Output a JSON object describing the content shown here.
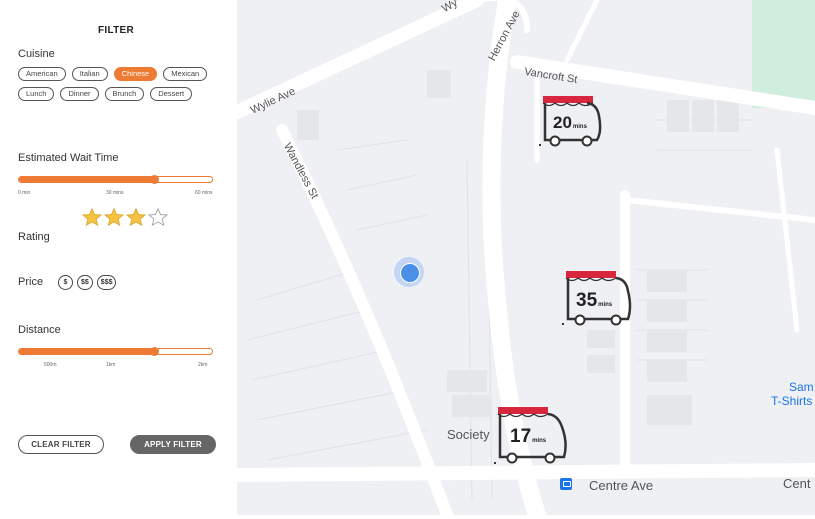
{
  "filter": {
    "title": "FILTER",
    "cuisine": {
      "label": "Cuisine",
      "options_row1": [
        "American",
        "Italian",
        "Chinese",
        "Mexican"
      ],
      "options_row2": [
        "Lunch",
        "Dinner",
        "Brunch",
        "Dessert"
      ],
      "selected": "Chinese"
    },
    "wait_time": {
      "label": "Estimated Wait Time",
      "value_fraction": 0.7,
      "ticks": [
        "0 min",
        "30 mins",
        "60 mins"
      ]
    },
    "rating": {
      "label": "Rating",
      "stars_filled": 3,
      "stars_total": 4
    },
    "price": {
      "label": "Price",
      "options": [
        "$",
        "$$",
        "$$$"
      ]
    },
    "distance": {
      "label": "Distance",
      "value_fraction": 0.7,
      "ticks": [
        "500m",
        "1km",
        "2km"
      ]
    },
    "clear_label": "CLEAR FILTER",
    "apply_label": "APPLY FILTER"
  },
  "map": {
    "streets": {
      "wylie_top": "Wy",
      "herron": "Herron Ave",
      "vancroft": "Vancroft St",
      "wylie": "Wylie Ave",
      "wandless": "Wandless St",
      "centre": "Centre Ave",
      "centre_right": "Cent"
    },
    "places": {
      "society": "Society",
      "poi_line1": "Sam",
      "poi_line2": "T-Shirts"
    },
    "trucks": [
      {
        "time": "20",
        "unit": "mins"
      },
      {
        "time": "35",
        "unit": "mins"
      },
      {
        "time": "17",
        "unit": "mins"
      }
    ]
  },
  "colors": {
    "accent": "#ef7a33",
    "button_dark": "#666666",
    "user_location": "#4a90e8",
    "map_bg": "#eef0f3",
    "road": "#ffffff",
    "park": "#cfeedd"
  }
}
